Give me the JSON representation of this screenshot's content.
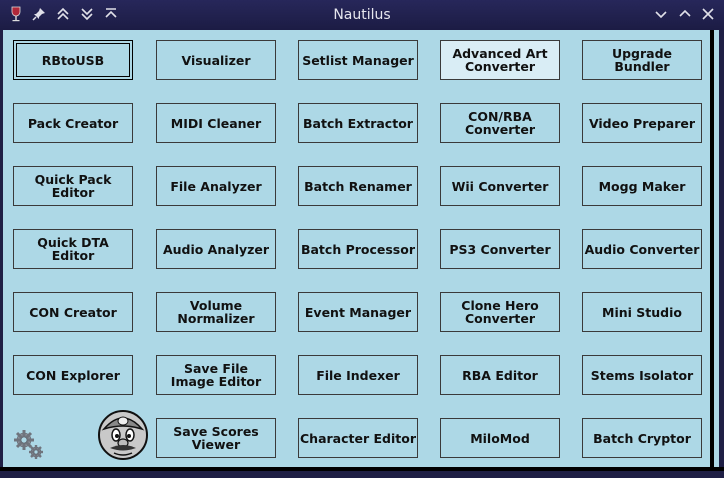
{
  "window": {
    "title": "Nautilus"
  },
  "titlebar_icons": [
    "wine-glass-icon",
    "pin-icon",
    "shade-up-icon",
    "shade-down-icon",
    "maximize-vertical-icon"
  ],
  "window_controls": [
    "minimize-icon",
    "maximize-icon",
    "close-icon"
  ],
  "buttons": [
    [
      "RBtoUSB",
      "Visualizer",
      "Setlist Manager",
      "Advanced Art\nConverter",
      "Upgrade Bundler"
    ],
    [
      "Pack Creator",
      "MIDI Cleaner",
      "Batch Extractor",
      "CON/RBA\nConverter",
      "Video Preparer"
    ],
    [
      "Quick Pack\nEditor",
      "File Analyzer",
      "Batch Renamer",
      "Wii Converter",
      "Mogg Maker"
    ],
    [
      "Quick DTA Editor",
      "Audio Analyzer",
      "Batch Processor",
      "PS3 Converter",
      "Audio Converter"
    ],
    [
      "CON Creator",
      "Volume\nNormalizer",
      "Event Manager",
      "Clone Hero\nConverter",
      "Mini Studio"
    ],
    [
      "CON Explorer",
      "Save File\nImage Editor",
      "File Indexer",
      "RBA Editor",
      "Stems Isolator"
    ],
    [
      "",
      "Save Scores\nViewer",
      "Character Editor",
      "MiloMod",
      "Batch Cryptor"
    ]
  ],
  "icons": {
    "settings": "gears-icon",
    "avatar": "mario-face-icon"
  }
}
